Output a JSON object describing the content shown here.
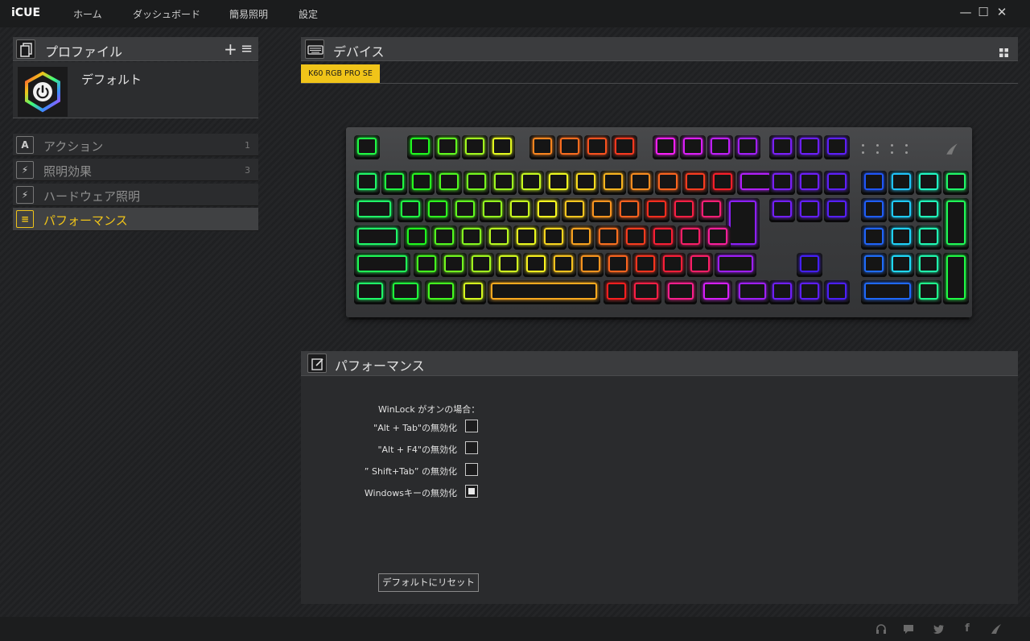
{
  "app": {
    "logo": "iCUE"
  },
  "nav": {
    "items": [
      "ホーム",
      "ダッシュボード",
      "簡易照明",
      "設定"
    ]
  },
  "window_controls": {
    "minimize": "—",
    "maximize": "☐",
    "close": "✕"
  },
  "profiles": {
    "title": "プロファイル",
    "add_label": "+",
    "menu_label": "≡",
    "current_name": "デフォルト"
  },
  "sidebar": {
    "items": [
      {
        "label": "アクション",
        "count": "1",
        "icon": "A"
      },
      {
        "label": "照明効果",
        "count": "3",
        "icon": "⚡"
      },
      {
        "label": "ハードウェア照明",
        "count": "",
        "icon": "⚡"
      },
      {
        "label": "パフォーマンス",
        "count": "",
        "icon": "≡"
      }
    ],
    "active_index": 3
  },
  "device_panel": {
    "title": "デバイス",
    "device_tab": "K60 RGB PRO SE"
  },
  "performance": {
    "title": "パフォーマンス",
    "winlock_heading": "WinLock がオンの場合：",
    "options": [
      {
        "label": "\"Alt + Tab\"の無効化",
        "checked": false
      },
      {
        "label": "\"Alt + F4\"の無効化",
        "checked": false
      },
      {
        "label": "” Shift+Tab” の無効化",
        "checked": false
      },
      {
        "label": "Windowsキーの無効化",
        "checked": true
      }
    ],
    "reset_label": "デフォルトにリセット"
  },
  "colors": {
    "accent": "#f0c419",
    "panel_header": "#3b3c3e"
  },
  "footer_icons": [
    "headset-icon",
    "chat-icon",
    "twitter-icon",
    "facebook-icon",
    "corsair-logo-icon"
  ]
}
